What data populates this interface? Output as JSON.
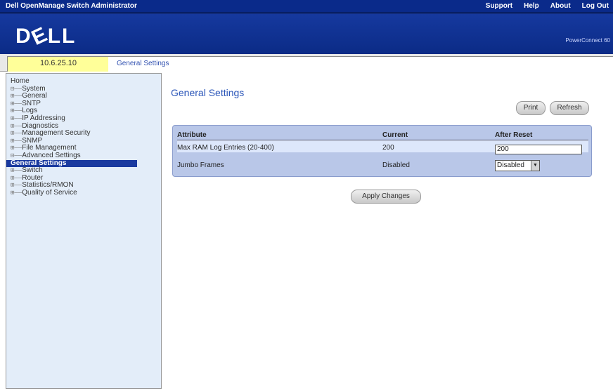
{
  "topbar": {
    "app_title": "Dell OpenManage Switch Administrator",
    "links": [
      "Support",
      "Help",
      "About",
      "Log Out"
    ]
  },
  "banner": {
    "logo": "DELL",
    "product": "PowerConnect 60"
  },
  "infobar": {
    "ip": "10.6.25.10",
    "breadcrumb": "General Settings"
  },
  "tree": [
    {
      "label": "Home",
      "branch": ""
    },
    {
      "label": "System",
      "branch": "⊟——"
    },
    {
      "label": "General",
      "branch": "   ⊞——"
    },
    {
      "label": "SNTP",
      "branch": "   ⊞——"
    },
    {
      "label": "Logs",
      "branch": "   ⊞——"
    },
    {
      "label": "IP Addressing",
      "branch": "   ⊞——"
    },
    {
      "label": "Diagnostics",
      "branch": "   ⊞——"
    },
    {
      "label": "Management Security",
      "branch": "   ⊞——"
    },
    {
      "label": "SNMP",
      "branch": "   ⊞——"
    },
    {
      "label": "File Management",
      "branch": "   ⊞——"
    },
    {
      "label": "Advanced Settings",
      "branch": "   ⊟——"
    },
    {
      "label": "General Settings",
      "branch": "              ",
      "selected": true
    },
    {
      "label": "Switch",
      "branch": "⊞——"
    },
    {
      "label": "Router",
      "branch": "⊞——"
    },
    {
      "label": "Statistics/RMON",
      "branch": "⊞——"
    },
    {
      "label": "Quality of Service",
      "branch": "⊞——"
    }
  ],
  "main": {
    "title": "General Settings",
    "print_label": "Print",
    "refresh_label": "Refresh",
    "apply_label": "Apply Changes"
  },
  "table": {
    "headers": [
      "Attribute",
      "Current",
      "After Reset"
    ],
    "rows": [
      {
        "attribute": "Max RAM Log Entries (20-400)",
        "current": "200",
        "after_reset": "200"
      },
      {
        "attribute": "Jumbo Frames",
        "current": "Disabled",
        "after_reset": "Disabled"
      }
    ]
  }
}
